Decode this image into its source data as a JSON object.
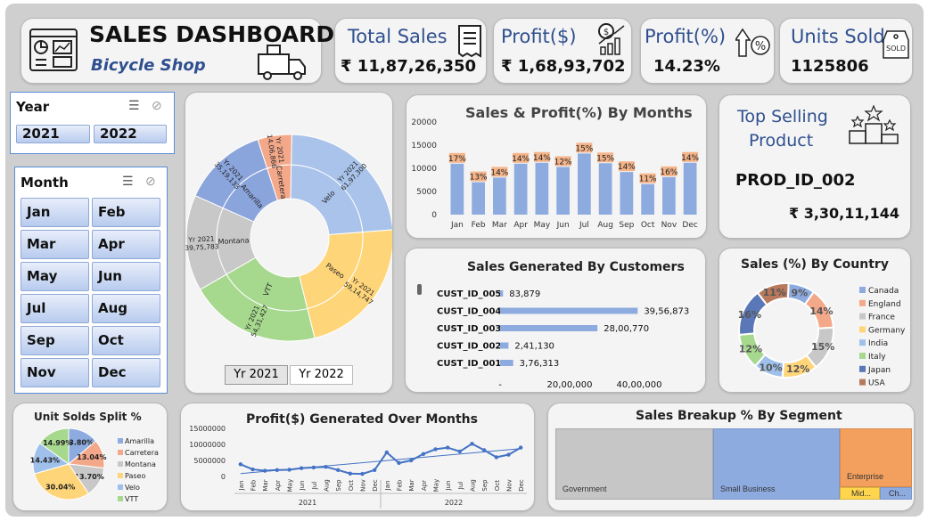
{
  "header": {
    "title": "SALES DASHBOARD",
    "subtitle": "Bicycle Shop"
  },
  "kpis": [
    {
      "title": "Total Sales",
      "value": "₹ 11,87,26,350",
      "icon": "receipt-icon"
    },
    {
      "title": "Profit($)",
      "value": "₹ 1,68,93,702",
      "icon": "money-growth-icon"
    },
    {
      "title": "Profit(%)",
      "value": "14.23%",
      "icon": "percent-arrow-icon"
    },
    {
      "title": "Units Sold",
      "value": "1125806",
      "icon": "sold-tag-icon"
    }
  ],
  "year_slicer": {
    "title": "Year",
    "items": [
      "2021",
      "2022"
    ]
  },
  "month_slicer": {
    "title": "Month",
    "items": [
      "Jan",
      "Feb",
      "Mar",
      "Apr",
      "May",
      "Jun",
      "Jul",
      "Aug",
      "Sep",
      "Oct",
      "Nov",
      "Dec"
    ]
  },
  "sunburst": {
    "tabs": [
      "Yr 2021",
      "Yr 2022"
    ],
    "inner": [
      {
        "label": "Velo",
        "value": 61.97,
        "color": "#a9c3ea"
      },
      {
        "label": "Paseo",
        "value": 59.15,
        "color": "#ffd57a"
      },
      {
        "label": "VTT",
        "value": 54.31,
        "color": "#a6d88e"
      },
      {
        "label": "Montana",
        "value": 39.76,
        "color": "#c8c8c8"
      },
      {
        "label": "Amarilla",
        "value": 35.19,
        "color": "#8aa4dc"
      },
      {
        "label": "Carretera",
        "value": 14.07,
        "color": "#f4a88a"
      }
    ],
    "outer_labels": [
      "Yr 2021\n61,97,300",
      "Yr 2021\n59,14,747",
      "Yr 2021\n54,31,427",
      "Yr 2021\n39,75,783",
      "Yr 2021\n35,19,133",
      "Yr 2021\n14,06,866"
    ]
  },
  "top_product": {
    "title_line1": "Top Selling",
    "title_line2": "Product",
    "product": "PROD_ID_002",
    "value": "₹ 3,30,11,144"
  },
  "chart_data": [
    {
      "type": "bar",
      "title": "Sales & Profit(%) By Months",
      "categories": [
        "Jan",
        "Feb",
        "Mar",
        "Apr",
        "May",
        "Jun",
        "Jul",
        "Aug",
        "Sep",
        "Oct",
        "Nov",
        "Dec"
      ],
      "values": [
        11000,
        7000,
        8000,
        11000,
        11200,
        10300,
        13200,
        11100,
        9200,
        6600,
        8100,
        11200
      ],
      "data_labels": [
        "17%",
        "13%",
        "14%",
        "14%",
        "14%",
        "12%",
        "15%",
        "15%",
        "14%",
        "11%",
        "16%",
        "14%"
      ],
      "yticks": [
        "20000",
        "15000",
        "10000",
        "5000",
        "0"
      ],
      "ylim": [
        0,
        20000
      ],
      "color": "#8eabe0"
    },
    {
      "type": "bar",
      "orientation": "horizontal",
      "title": "Sales Generated By Customers",
      "categories": [
        "CUST_ID_005",
        "CUST_ID_004",
        "CUST_ID_003",
        "CUST_ID_002",
        "CUST_ID_001"
      ],
      "values": [
        83879,
        3956873,
        2800770,
        241130,
        376313
      ],
      "data_labels": [
        "83,879",
        "39,56,873",
        "28,00,770",
        "2,41,130",
        "3,76,313"
      ],
      "xticks": [
        "-",
        "20,00,000",
        "40,00,000"
      ],
      "xlim": [
        0,
        4000000
      ],
      "color": "#8eabe0"
    },
    {
      "type": "pie",
      "title": "Sales (%) By Country",
      "donut": true,
      "categories": [
        "Canada",
        "England",
        "France",
        "Germany",
        "India",
        "Italy",
        "Japan",
        "USA"
      ],
      "values": [
        9,
        14,
        15,
        12,
        10,
        12,
        16,
        11
      ],
      "data_labels": [
        "9%",
        "14%",
        "15%",
        "12%",
        "10%",
        "12%",
        "16%",
        "11%"
      ],
      "colors": [
        "#8eabe0",
        "#f4a88a",
        "#c8c8c8",
        "#ffd57a",
        "#9fc0ea",
        "#a6d88e",
        "#5a78b8",
        "#b9795c"
      ],
      "legend": "right"
    },
    {
      "type": "pie",
      "title": "Unit Solds Split %",
      "categories": [
        "Amarilla",
        "Carretera",
        "Montana",
        "Paseo",
        "Velo",
        "VTT"
      ],
      "values": [
        13.8,
        13.04,
        13.7,
        30.04,
        14.43,
        14.99
      ],
      "data_labels": [
        "13.80%",
        "13.04%",
        "13.70%",
        "30.04%",
        "14.43%",
        "14.99%"
      ],
      "colors": [
        "#8eabe0",
        "#f4a88a",
        "#c8c8c8",
        "#ffd57a",
        "#9fc0ea",
        "#a6d88e"
      ],
      "legend": "right"
    },
    {
      "type": "line",
      "title": "Profit($) Generated Over Months",
      "categories": [
        "Jan",
        "Feb",
        "Mar",
        "Apr",
        "May",
        "Jun",
        "Jul",
        "Aug",
        "Sep",
        "Oct",
        "Nov",
        "Dec",
        "Jan",
        "Feb",
        "Mar",
        "Apr",
        "May",
        "Jun",
        "Jul",
        "Aug",
        "Sep",
        "Oct",
        "Nov",
        "Dec"
      ],
      "groups": [
        "2021",
        "2022"
      ],
      "values": [
        3800000,
        2200000,
        1800000,
        2000000,
        2100000,
        2600000,
        2800000,
        3000000,
        2000000,
        900000,
        800000,
        2000000,
        7500000,
        4200000,
        5000000,
        7000000,
        8500000,
        9000000,
        7800000,
        10200000,
        8200000,
        6000000,
        6800000,
        9000000
      ],
      "yticks": [
        "15000000",
        "10000000",
        "5000000",
        "0"
      ],
      "ylim": [
        0,
        15000000
      ],
      "trendline": true,
      "color": "#4472c4"
    },
    {
      "type": "treemap",
      "title": "Sales Breakup % By Segment",
      "categories": [
        "Government",
        "Small Business",
        "Enterprise",
        "Mid...",
        "Ch..."
      ],
      "colors": [
        "#c6c6c6",
        "#8eabe0",
        "#f3a05e",
        "#ffd54d",
        "#8eabe0"
      ]
    }
  ]
}
